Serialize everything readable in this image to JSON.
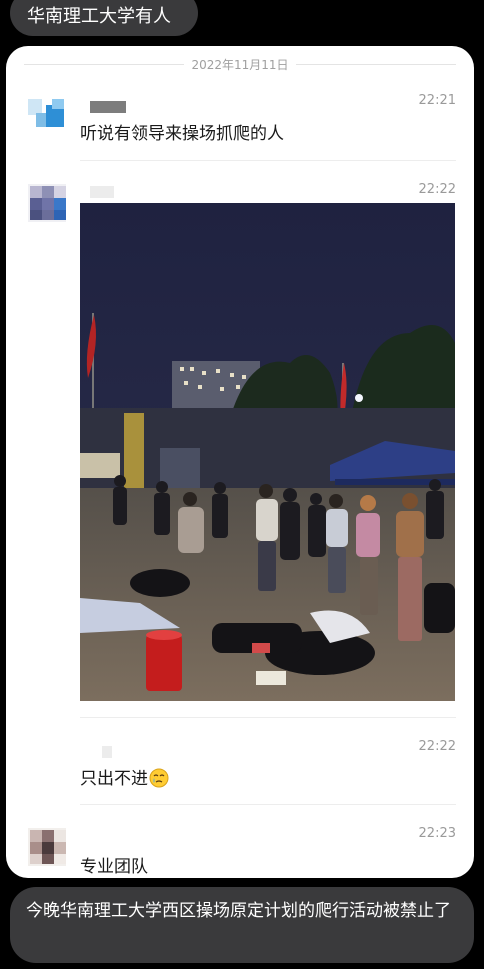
{
  "header_bubble": {
    "text": "华南理工大学有人"
  },
  "chat": {
    "date": "2022年11月11日",
    "messages": [
      {
        "time": "22:21",
        "text": "听说有领导来操场抓爬的人"
      },
      {
        "time": "22:22",
        "text": ""
      },
      {
        "time": "22:22",
        "text": "只出不进",
        "emoji": "crying-face-icon"
      },
      {
        "time": "22:23",
        "text": "专业团队"
      }
    ]
  },
  "footer_bubble": {
    "text": "今晚华南理工大学西区操场原定计划的爬行活动被禁止了"
  },
  "colors": {
    "bubble_bg": "#3a3a3c",
    "card_bg": "#ffffff",
    "page_bg": "#000000"
  }
}
